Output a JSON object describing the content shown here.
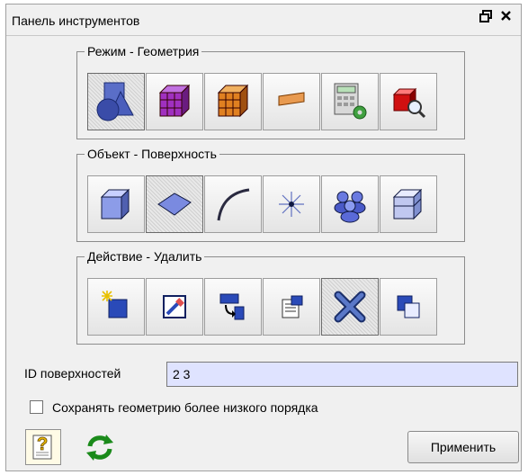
{
  "window": {
    "title": "Панель инструментов",
    "float_icon": "float-icon",
    "close_icon": "close-icon"
  },
  "groups": [
    {
      "label": "Режим - Геометрия",
      "tools": [
        {
          "name": "geometry-mode-icon",
          "active": true
        },
        {
          "name": "mesh-mode-icon",
          "active": false
        },
        {
          "name": "hex-block-icon",
          "active": false
        },
        {
          "name": "bar-icon",
          "active": false
        },
        {
          "name": "calculator-settings-icon",
          "active": false
        },
        {
          "name": "zoom-solid-icon",
          "active": false
        }
      ]
    },
    {
      "label": "Объект - Поверхность",
      "tools": [
        {
          "name": "volume-icon",
          "active": false
        },
        {
          "name": "surface-icon",
          "active": true
        },
        {
          "name": "curve-icon",
          "active": false
        },
        {
          "name": "vertex-icon",
          "active": false
        },
        {
          "name": "group-icon",
          "active": false
        },
        {
          "name": "body-icon",
          "active": false
        }
      ]
    },
    {
      "label": "Действие - Удалить",
      "tools": [
        {
          "name": "create-icon",
          "active": false
        },
        {
          "name": "modify-icon",
          "active": false
        },
        {
          "name": "transform-icon",
          "active": false
        },
        {
          "name": "properties-icon",
          "active": false
        },
        {
          "name": "delete-icon",
          "active": true
        },
        {
          "name": "copy-icon",
          "active": false
        }
      ]
    }
  ],
  "surface_ids": {
    "label": "ID поверхностей",
    "value": "2 3"
  },
  "keep_low_order": {
    "label": "Сохранять геометрию более низкого порядка",
    "checked": false
  },
  "buttons": {
    "apply_label": "Применить",
    "help_icon": "help-icon",
    "refresh_icon": "refresh-icon"
  }
}
